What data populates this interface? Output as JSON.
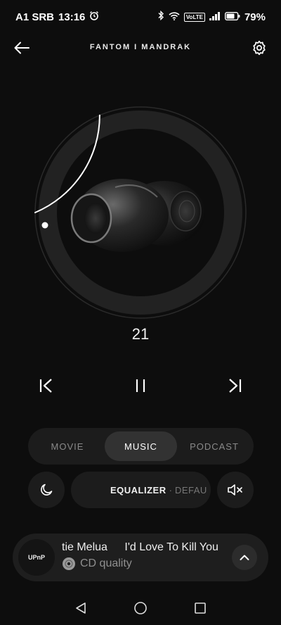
{
  "status_bar": {
    "carrier": "A1 SRB",
    "time": "13:16",
    "volte": "VoLTE",
    "battery": "79%"
  },
  "header": {
    "title": "FANTOM I MANDRAK"
  },
  "volume": {
    "value": "21",
    "level_fraction": 0.21
  },
  "modes": {
    "items": [
      "MOVIE",
      "MUSIC",
      "PODCAST"
    ],
    "active": "MUSIC"
  },
  "equalizer": {
    "label": "EQUALIZER",
    "separator": "·",
    "value": "DEFAU"
  },
  "player": {
    "source": "UPnP",
    "artist": "tie Melua",
    "title": "I'd Love To Kill You",
    "quality": "CD quality"
  },
  "colors": {
    "background": "#0d0d0d",
    "surface": "#1c1c1c",
    "active_tab": "#323232",
    "accent": "#ffffff",
    "muted_text": "#8a8a8a"
  }
}
